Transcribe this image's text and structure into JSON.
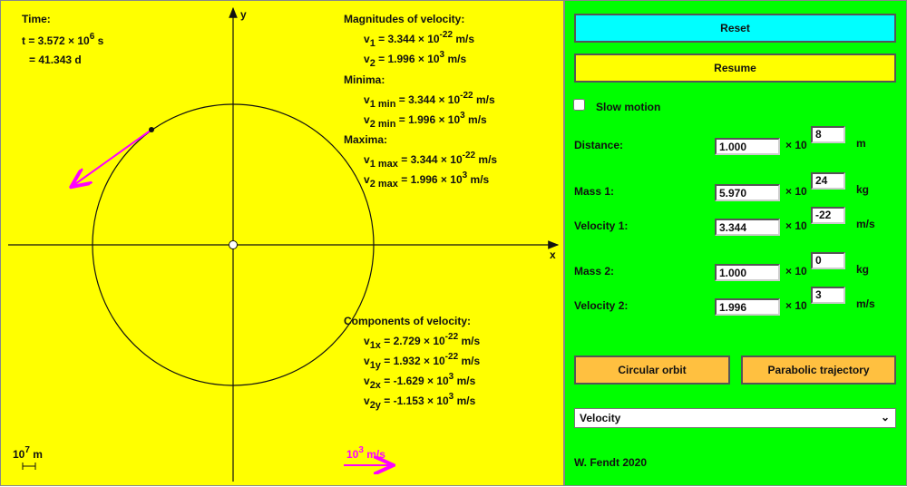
{
  "canvas": {
    "time_label": "Time:",
    "t_prefix": "t = 3.572 × 10",
    "t_exp": "6",
    "t_unit": " s",
    "t_days": "= 41.343 d",
    "axis_x": "x",
    "axis_y": "y",
    "magnitudes_title": "Magnitudes of velocity:",
    "v1": {
      "sym": "v",
      "sub": "1",
      "val": " = 3.344 × 10",
      "exp": "-22",
      "unit": " m/s"
    },
    "v2": {
      "sym": "v",
      "sub": "2",
      "val": " = 1.996 × 10",
      "exp": "3",
      "unit": " m/s"
    },
    "minima_title": "Minima:",
    "v1min": {
      "sym": "v",
      "sub": "1 min",
      "val": " = 3.344 × 10",
      "exp": "-22",
      "unit": " m/s"
    },
    "v2min": {
      "sym": "v",
      "sub": "2 min",
      "val": " = 1.996 × 10",
      "exp": "3",
      "unit": " m/s"
    },
    "maxima_title": "Maxima:",
    "v1max": {
      "sym": "v",
      "sub": "1 max",
      "val": " = 3.344 × 10",
      "exp": "-22",
      "unit": " m/s"
    },
    "v2max": {
      "sym": "v",
      "sub": "2 max",
      "val": " = 1.996 × 10",
      "exp": "3",
      "unit": " m/s"
    },
    "components_title": "Components of velocity:",
    "v1x": {
      "sym": "v",
      "sub": "1x",
      "val": " = 2.729 × 10",
      "exp": "-22",
      "unit": " m/s"
    },
    "v1y": {
      "sym": "v",
      "sub": "1y",
      "val": " = 1.932 × 10",
      "exp": "-22",
      "unit": " m/s"
    },
    "v2x": {
      "sym": "v",
      "sub": "2x",
      "val": " = -1.629 × 10",
      "exp": "3",
      "unit": " m/s"
    },
    "v2y": {
      "sym": "v",
      "sub": "2y",
      "val": " = -1.153 × 10",
      "exp": "3",
      "unit": " m/s"
    },
    "length_scale": {
      "base": "10",
      "exp": "7",
      "unit": " m"
    },
    "velocity_scale": {
      "base": "10",
      "exp": "3",
      "unit": " m/s"
    },
    "colors": {
      "background": "#ffff00",
      "velocity_arrow": "#ff00ff"
    }
  },
  "panel": {
    "reset_label": "Reset",
    "resume_label": "Resume",
    "slow_motion_label": "Slow motion",
    "slow_motion_checked": false,
    "times_ten": "× 10",
    "fields": [
      {
        "label": "Distance:",
        "mantissa": "1.000",
        "exponent": "8",
        "unit": "m"
      },
      {
        "label": "Mass 1:",
        "mantissa": "5.970",
        "exponent": "24",
        "unit": "kg"
      },
      {
        "label": "Velocity 1:",
        "mantissa": "3.344",
        "exponent": "-22",
        "unit": "m/s"
      },
      {
        "label": "Mass 2:",
        "mantissa": "1.000",
        "exponent": "0",
        "unit": "kg"
      },
      {
        "label": "Velocity 2:",
        "mantissa": "1.996",
        "exponent": "3",
        "unit": "m/s"
      }
    ],
    "circular_orbit_label": "Circular orbit",
    "parabolic_label": "Parabolic trajectory",
    "display_select": "Velocity",
    "credit": "W. Fendt 2020",
    "colors": {
      "background": "#00ff00",
      "reset": "#00ffff",
      "resume": "#ffff00",
      "orbit_buttons": "#ffc040"
    }
  }
}
